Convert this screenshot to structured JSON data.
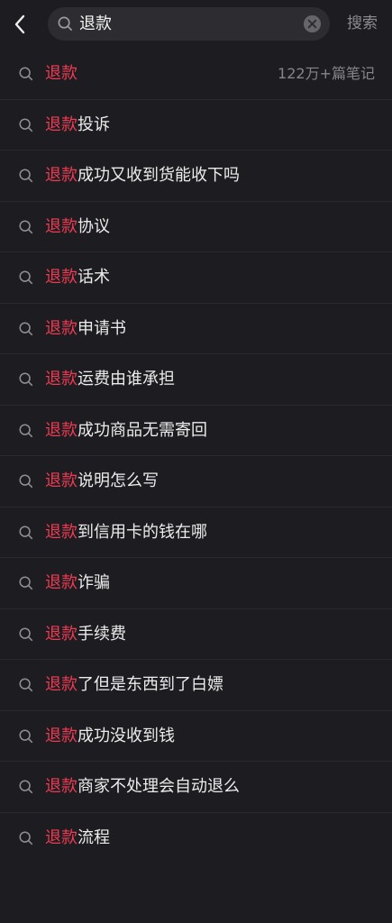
{
  "header": {
    "search_value": "退款",
    "search_button": "搜索"
  },
  "suggestions": [
    {
      "highlight": "退款",
      "rest": "",
      "count": "122万+篇笔记"
    },
    {
      "highlight": "退款",
      "rest": "投诉"
    },
    {
      "highlight": "退款",
      "rest": "成功又收到货能收下吗"
    },
    {
      "highlight": "退款",
      "rest": "协议"
    },
    {
      "highlight": "退款",
      "rest": "话术"
    },
    {
      "highlight": "退款",
      "rest": "申请书"
    },
    {
      "highlight": "退款",
      "rest": "运费由谁承担"
    },
    {
      "highlight": "退款",
      "rest": "成功商品无需寄回"
    },
    {
      "highlight": "退款",
      "rest": "说明怎么写"
    },
    {
      "highlight": "退款",
      "rest": "到信用卡的钱在哪"
    },
    {
      "highlight": "退款",
      "rest": "诈骗"
    },
    {
      "highlight": "退款",
      "rest": "手续费"
    },
    {
      "highlight": "退款",
      "rest": "了但是东西到了白嫖"
    },
    {
      "highlight": "退款",
      "rest": "成功没收到钱"
    },
    {
      "highlight": "退款",
      "rest": "商家不处理会自动退么"
    },
    {
      "highlight": "退款",
      "rest": "流程"
    }
  ],
  "colors": {
    "background": "#1d1d21",
    "highlight": "#ef3b53",
    "search_box": "#2d2d31"
  }
}
